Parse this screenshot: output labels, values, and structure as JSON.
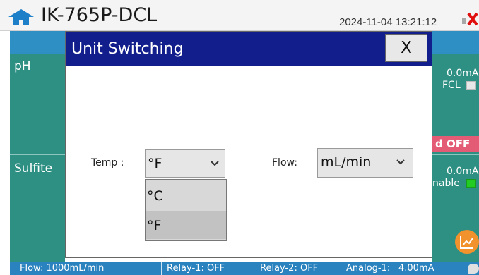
{
  "header": {
    "title": "IK-765P-DCL",
    "datetime": "2024-11-04 13:21:12",
    "home_icon": "home-icon",
    "alarm_icon": "alarm-x-icon"
  },
  "left_panel": {
    "items": [
      {
        "label": "pH"
      },
      {
        "label": "Sulfite"
      }
    ]
  },
  "right_panel": {
    "ph_current": "0.0mA",
    "ph_toggle_label": "FCL",
    "off_status": "d OFF",
    "sulfite_current": "0.0mA",
    "sulfite_toggle_label": "nable"
  },
  "modal": {
    "title": "Unit Switching",
    "close_label": "X",
    "temp": {
      "label": "Temp :",
      "selected": "°F",
      "options": [
        "°C",
        "°F"
      ]
    },
    "flow": {
      "label": "Flow:",
      "selected": "mL/min"
    }
  },
  "status_bar": {
    "flow": "Flow: 1000mL/min",
    "relay1": "Relay-1: OFF",
    "relay2": "Relay-2: OFF",
    "analog1_label": "Analog-1:",
    "analog1_value": "4.00mA"
  },
  "colors": {
    "header_blue": "#111e8c",
    "panel_teal": "#2e8f83",
    "status_blue": "#2a82be",
    "alarm_red": "#e35b74",
    "chart_orange": "#f1922c"
  },
  "icons": {
    "chart": "line-chart-icon",
    "chat": "chat-bubble-icon",
    "dropdown": "chevron-down-icon"
  }
}
